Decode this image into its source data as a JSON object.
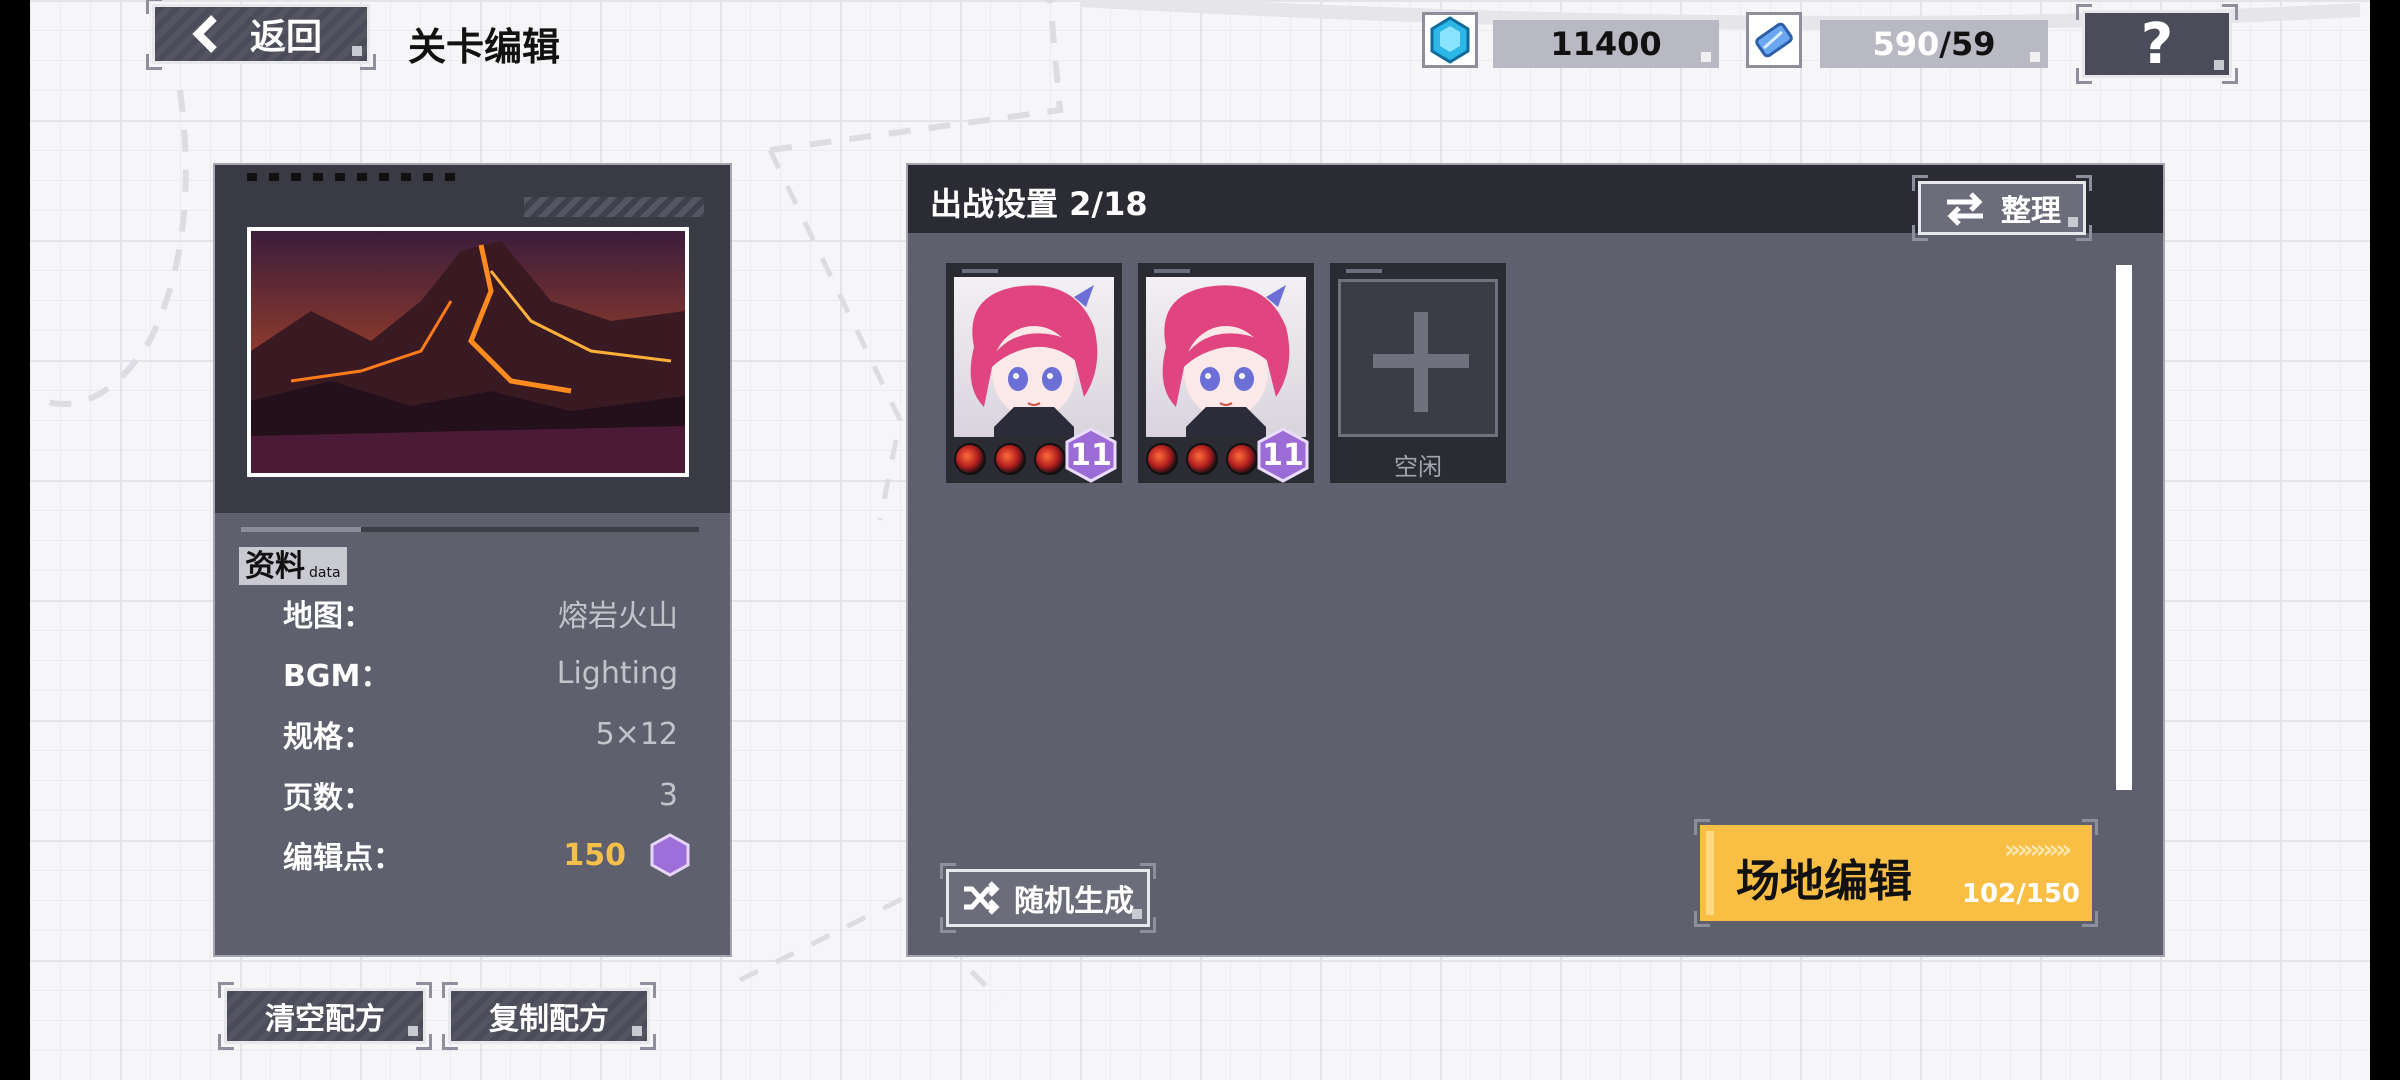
{
  "header": {
    "back_label": "返回",
    "page_title": "关卡编辑"
  },
  "resources": {
    "gems": "11400",
    "tickets_current": "590",
    "tickets_max": "/59",
    "help_label": "?"
  },
  "info_panel": {
    "map_preview": "volcano-landscape",
    "data_tag": "资料",
    "data_tag_sub": "data",
    "rows": [
      {
        "label": "地图：",
        "value": "熔岩火山"
      },
      {
        "label": "BGM：",
        "value": "Lighting"
      },
      {
        "label": "规格：",
        "value": "5×12"
      },
      {
        "label": "页数：",
        "value": "3"
      },
      {
        "label": "编辑点：",
        "value": "150"
      }
    ],
    "clear_label": "清空配方",
    "copy_label": "复制配方"
  },
  "battle_panel": {
    "title": "出战设置 2/18",
    "sort_label": "整理",
    "units": [
      {
        "level": "11",
        "portrait": "pink-haired-girl"
      },
      {
        "level": "11",
        "portrait": "pink-haired-girl"
      }
    ],
    "empty_slot_label": "空闲",
    "random_label": "随机生成",
    "field_edit_label": "场地编辑",
    "field_edit_count": "102/150",
    "field_edit_chevrons": "»»»»»"
  },
  "colors": {
    "panel": "#5e606d",
    "panel_header": "#2b2c33",
    "button_dark": "#4b4c59",
    "accent_yellow": "#f9bf45",
    "gold_text": "#f5c04a",
    "level_purple": "#9b6bd6"
  }
}
